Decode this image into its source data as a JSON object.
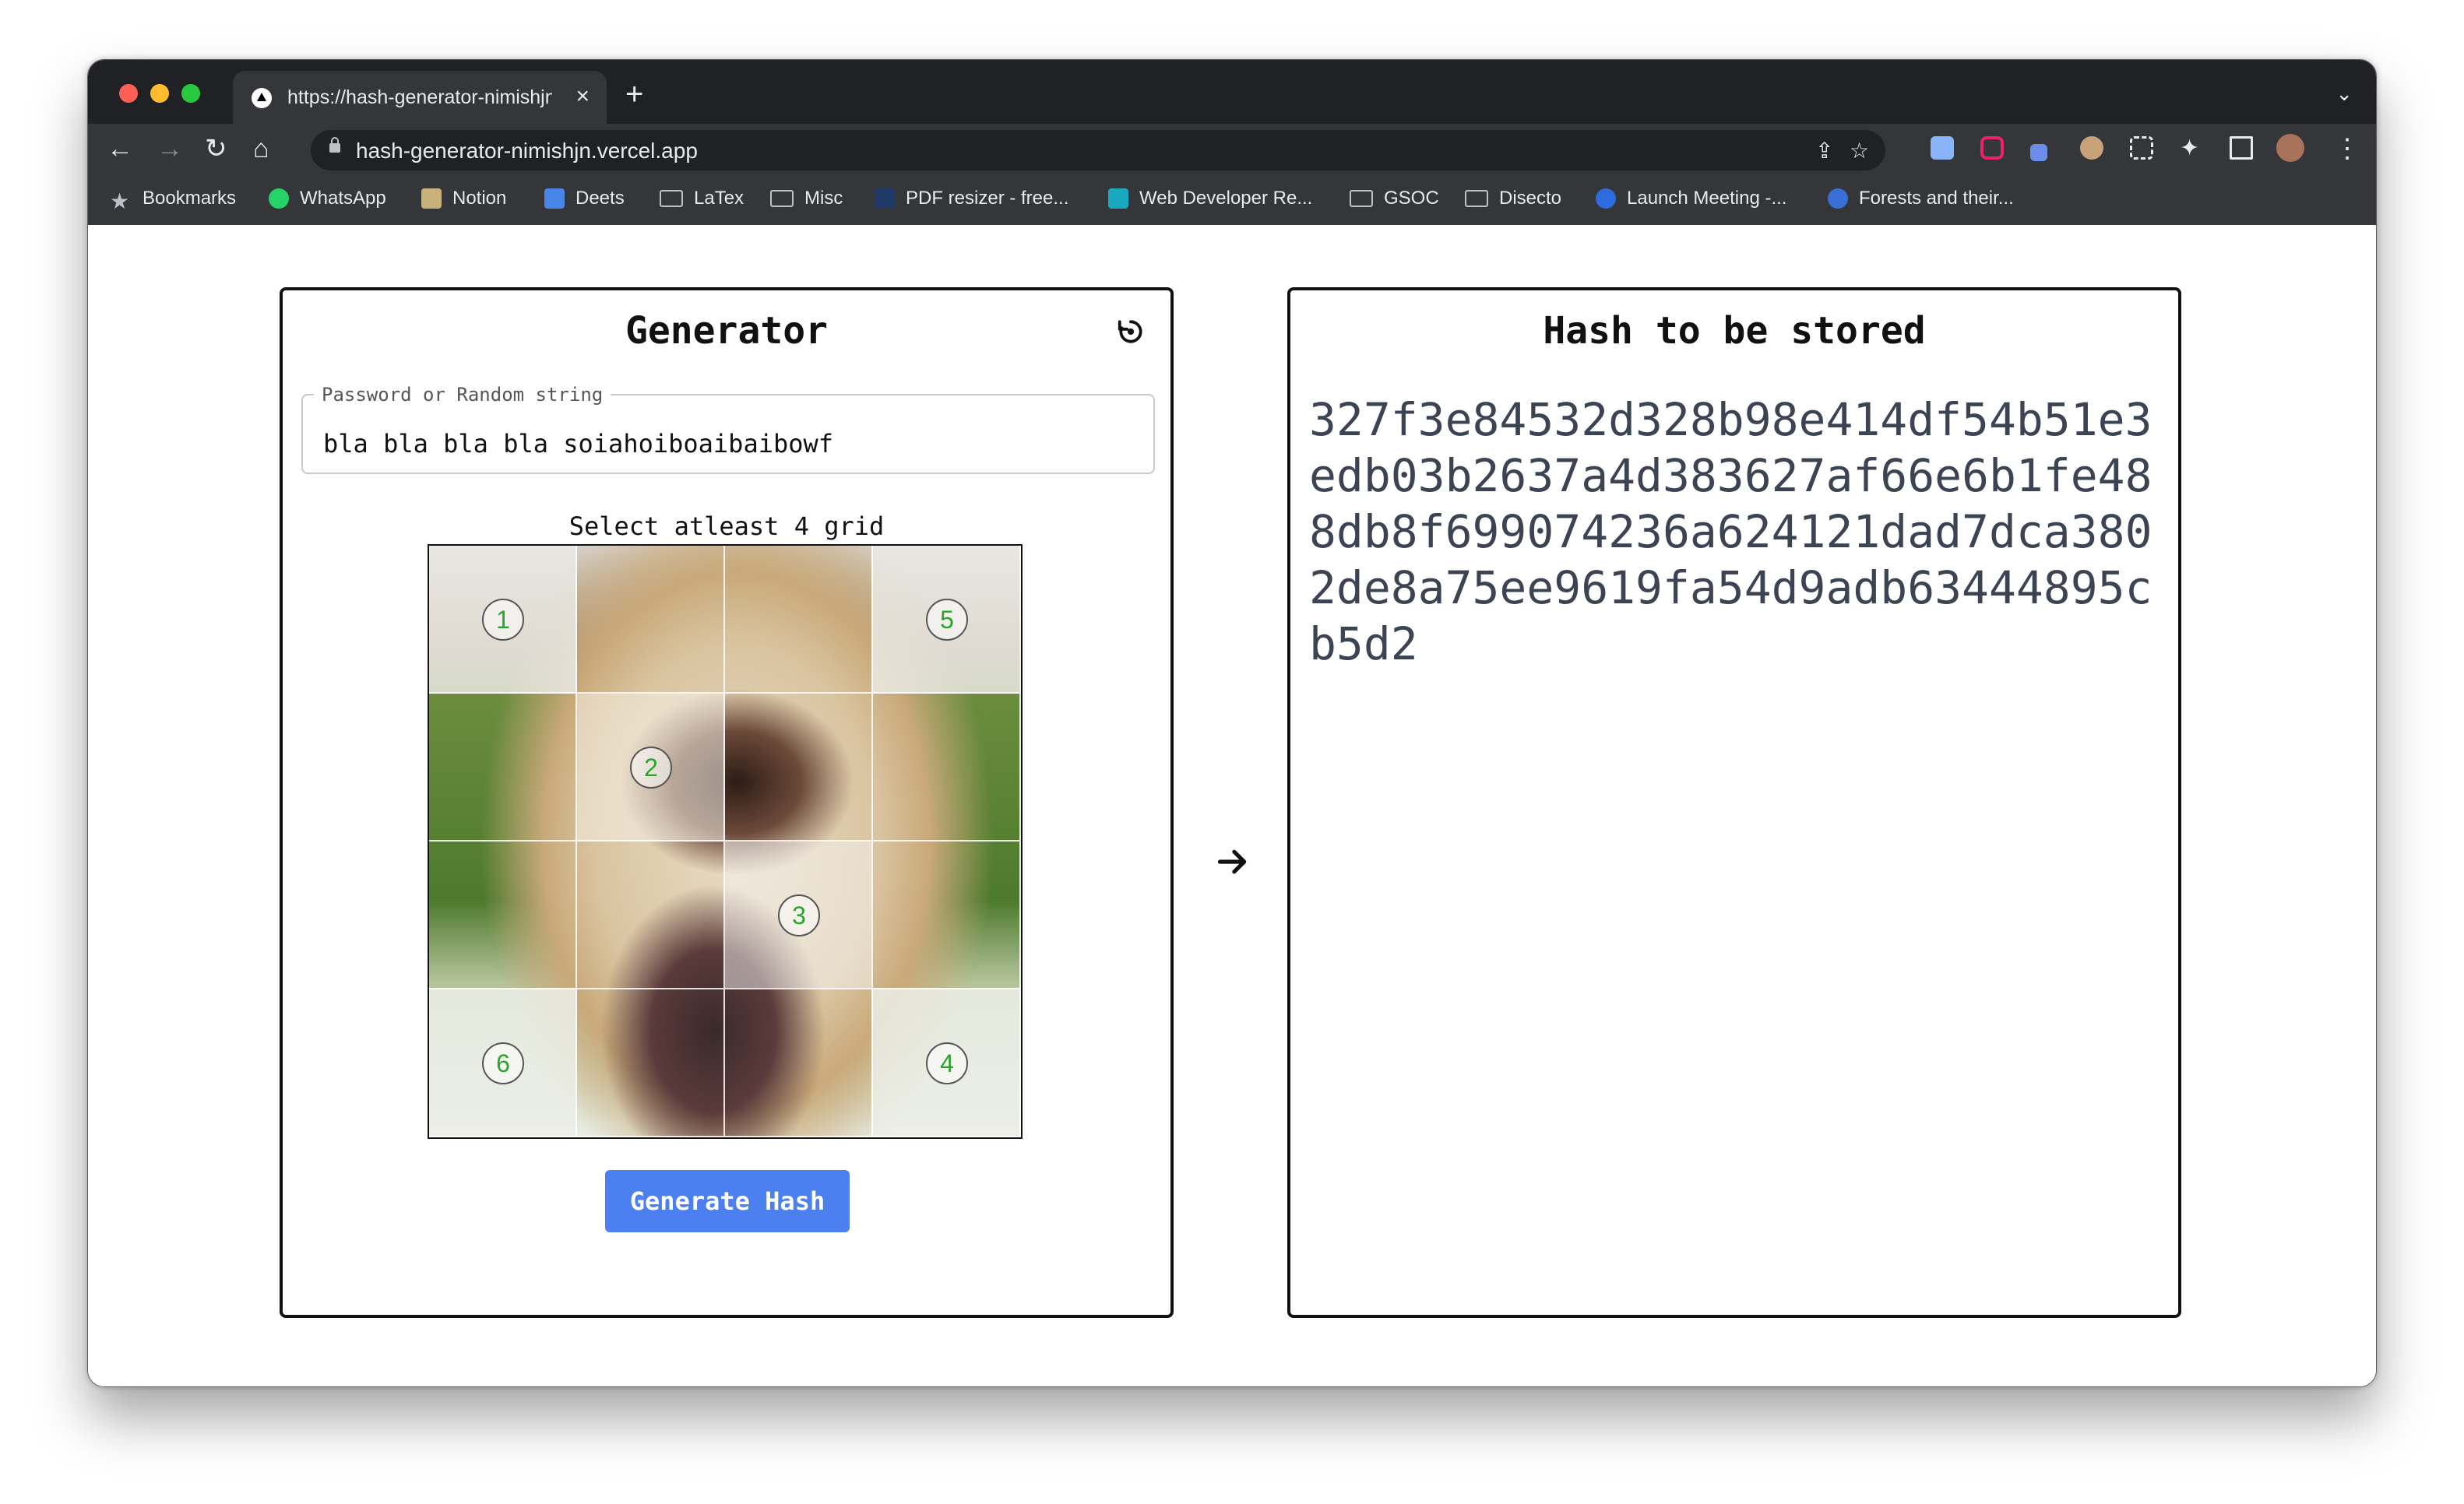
{
  "browser": {
    "tab_title": "https://hash-generator-nimishjn.vercel.app",
    "address": "hash-generator-nimishjn.vercel.app",
    "bookmarks": [
      "Bookmarks",
      "WhatsApp",
      "Notion",
      "Deets",
      "LaTex",
      "Misc",
      "PDF resizer - free...",
      "Web Developer Re...",
      "GSOC",
      "Disecto",
      "Launch Meeting -...",
      "Forests and their..."
    ]
  },
  "generator": {
    "title": "Generator",
    "field_legend": "Password or Random string",
    "field_value": "bla bla bla bla soiahoiboaibaibowf",
    "grid_hint": "Select atleast 4 grid",
    "selected_cells": [
      {
        "order": "1",
        "row": 0,
        "col": 0
      },
      {
        "order": "5",
        "row": 0,
        "col": 3
      },
      {
        "order": "2",
        "row": 1,
        "col": 1
      },
      {
        "order": "3",
        "row": 2,
        "col": 2
      },
      {
        "order": "6",
        "row": 3,
        "col": 0
      },
      {
        "order": "4",
        "row": 3,
        "col": 3
      }
    ],
    "button_label": "Generate Hash",
    "accent_color": "#4c80f0",
    "badge_color": "#2aa52a"
  },
  "result": {
    "title": "Hash to be stored",
    "hash": "327f3e84532d328b98e414df54b51e3edb03b2637a4d383627af66e6b1fe488db8f699074236a624121dad7dca3802de8a75ee9619fa54d9adb63444895cb5d2"
  }
}
